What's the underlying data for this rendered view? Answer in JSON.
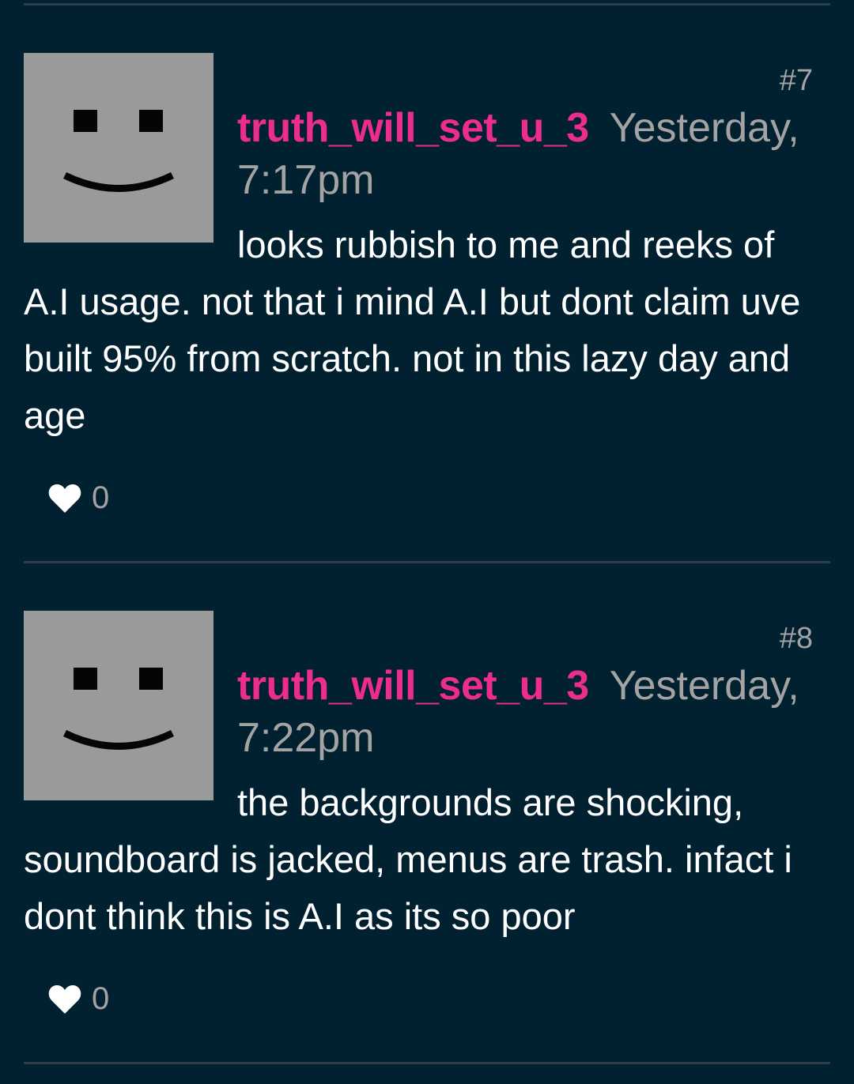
{
  "posts": [
    {
      "number": "#7",
      "username": "truth_will_set_u_3",
      "timestamp": "Yesterday, 7:17pm",
      "body": "looks rubbish to me and reeks of A.I usage. not that i mind A.I but dont claim uve built 95% from scratch. not in this lazy day and age",
      "likes": "0",
      "avatar_icon": "smiley-face-icon",
      "like_icon": "heart-icon"
    },
    {
      "number": "#8",
      "username": "truth_will_set_u_3",
      "timestamp": "Yesterday, 7:22pm",
      "body": "the backgrounds are shocking, soundboard is jacked, menus are trash. infact i dont think this is A.I as its so poor",
      "likes": "0",
      "avatar_icon": "smiley-face-icon",
      "like_icon": "heart-icon"
    }
  ],
  "colors": {
    "background": "#022130",
    "username": "#ec2d8c",
    "muted": "#a3a3a3",
    "text": "#ffffff",
    "avatar": "#9a9a9a"
  }
}
